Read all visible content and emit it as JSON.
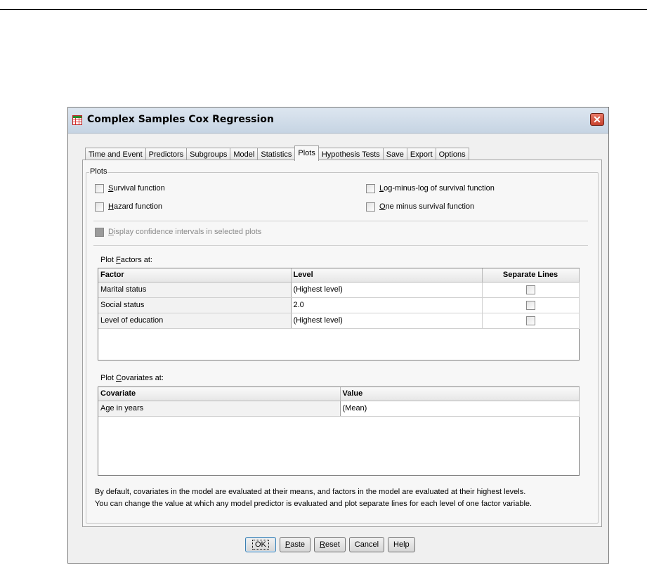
{
  "window": {
    "title": "Complex Samples Cox Regression",
    "close_glyph": "✕"
  },
  "tabs": [
    {
      "label": "Time and Event",
      "active": false
    },
    {
      "label": "Predictors",
      "active": false
    },
    {
      "label": "Subgroups",
      "active": false
    },
    {
      "label": "Model",
      "active": false
    },
    {
      "label": "Statistics",
      "active": false
    },
    {
      "label": "Plots",
      "active": true
    },
    {
      "label": "Hypothesis Tests",
      "active": false
    },
    {
      "label": "Save",
      "active": false
    },
    {
      "label": "Export",
      "active": false
    },
    {
      "label": "Options",
      "active": false
    }
  ],
  "plots_group": {
    "legend": "Plots",
    "survival_mnemonic": "S",
    "survival_rest": "urvival function",
    "hazard_mnemonic": "H",
    "hazard_rest": "azard function",
    "loglog_mnemonic": "L",
    "loglog_rest": "og-minus-log of survival function",
    "oneminus_mnemonic": "O",
    "oneminus_rest": "ne minus survival function",
    "ci_mnemonic": "D",
    "ci_rest": "isplay confidence intervals in selected plots",
    "checked": {
      "survival": false,
      "hazard": false,
      "loglog": false,
      "oneminus": false,
      "ci": false
    }
  },
  "factors": {
    "label_pre": "Plot ",
    "label_mnemonic": "F",
    "label_post": "actors at:",
    "columns": [
      "Factor",
      "Level",
      "Separate Lines"
    ],
    "rows": [
      {
        "factor": "Marital status",
        "level": "(Highest level)",
        "separate": false
      },
      {
        "factor": "Social status",
        "level": "2.0",
        "separate": false
      },
      {
        "factor": "Level of education",
        "level": "(Highest level)",
        "separate": false
      }
    ]
  },
  "covariates": {
    "label_pre": "Plot ",
    "label_mnemonic": "C",
    "label_post": "ovariates at:",
    "columns": [
      "Covariate",
      "Value"
    ],
    "rows": [
      {
        "covariate": "Age in years",
        "value": "(Mean)"
      }
    ]
  },
  "note": {
    "line1": "By default, covariates in the model are evaluated at their means, and factors in the model are evaluated at their highest levels.",
    "line2": "You can change the value at which any model predictor is evaluated and plot separate lines for each level of one factor variable."
  },
  "buttons": {
    "ok": "OK",
    "paste_mnemonic": "P",
    "paste_rest": "aste",
    "reset_mnemonic": "R",
    "reset_rest": "eset",
    "cancel": "Cancel",
    "help": "Help"
  }
}
